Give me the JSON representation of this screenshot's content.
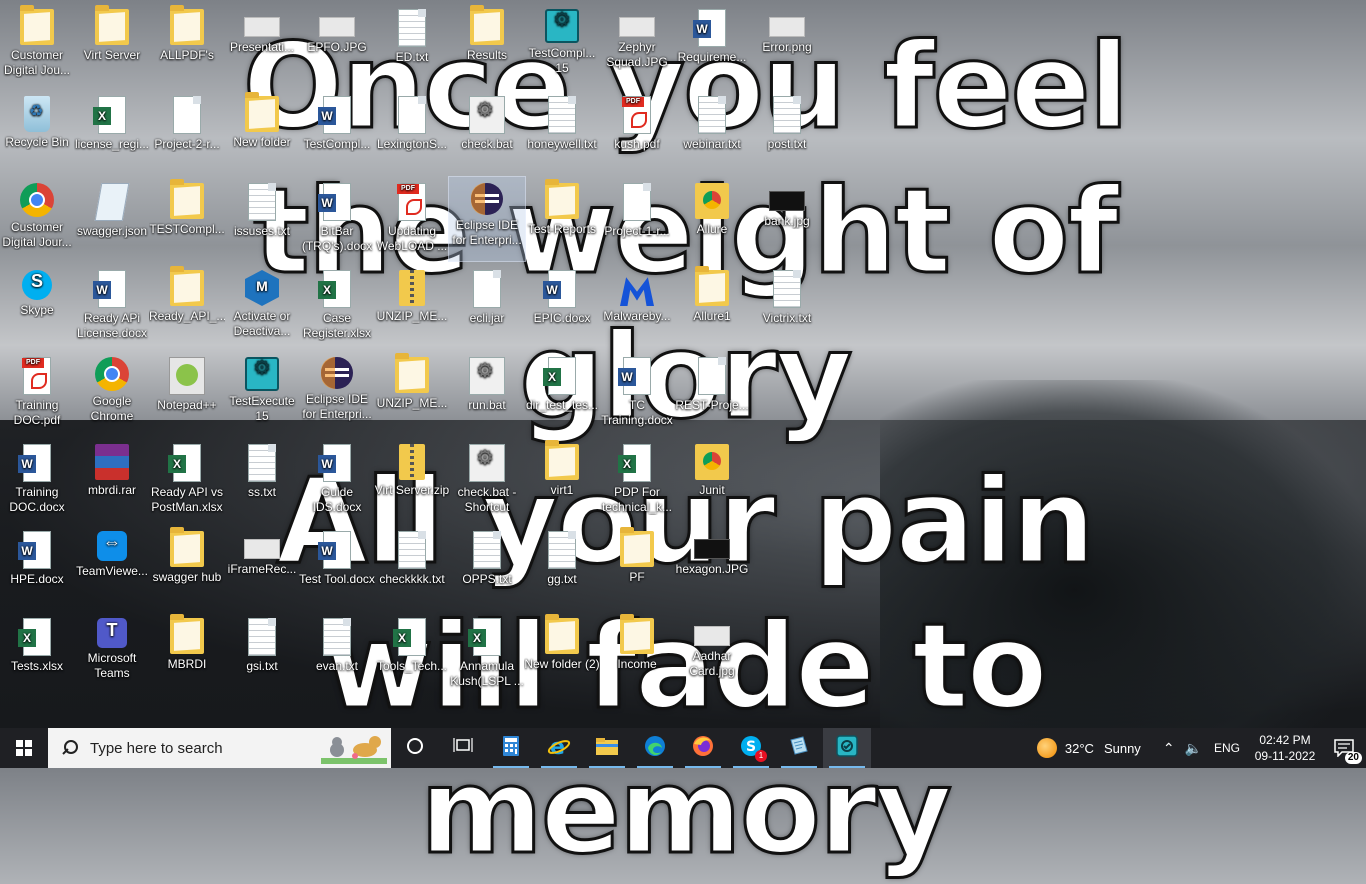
{
  "wallpaper": {
    "text": "Once you feel\nthe weight of glory\nAll your pain\nwill fade to\nmemory"
  },
  "desktop_icons": [
    {
      "label": "Customer Digital Jou...",
      "icon": "folder-icon"
    },
    {
      "label": "Recycle Bin",
      "icon": "recycle-bin-icon"
    },
    {
      "label": "Customer Digital Jour...",
      "icon": "chrome-icon"
    },
    {
      "label": "Skype",
      "icon": "skype-icon"
    },
    {
      "label": "Training DOC.pdf",
      "icon": "pdf-icon"
    },
    {
      "label": "Training DOC.docx",
      "icon": "word-icon"
    },
    {
      "label": "HPE.docx",
      "icon": "word-icon"
    },
    {
      "label": "Tests.xlsx",
      "icon": "excel-icon"
    },
    {
      "label": "Virt Server",
      "icon": "folder-icon"
    },
    {
      "label": "license_regi...",
      "icon": "excel-icon"
    },
    {
      "label": "swagger.json",
      "icon": "json-icon"
    },
    {
      "label": "Ready APi License.docx",
      "icon": "word-icon"
    },
    {
      "label": "Google Chrome",
      "icon": "chrome-icon"
    },
    {
      "label": "mbrdi.rar",
      "icon": "rar-icon"
    },
    {
      "label": "TeamViewe...",
      "icon": "teamviewer-icon"
    },
    {
      "label": "Microsoft Teams",
      "icon": "teams-icon"
    },
    {
      "label": "ALLPDF's",
      "icon": "folder-icon"
    },
    {
      "label": "Project-2-r...",
      "icon": "doc-icon"
    },
    {
      "label": "TESTCompl...",
      "icon": "folder-icon"
    },
    {
      "label": "Ready_API_...",
      "icon": "folder-icon"
    },
    {
      "label": "Notepad++",
      "icon": "notepadpp-icon"
    },
    {
      "label": "Ready API vs PostMan.xlsx",
      "icon": "excel-icon"
    },
    {
      "label": "swagger hub",
      "icon": "folder-icon"
    },
    {
      "label": "MBRDI",
      "icon": "folder-icon"
    },
    {
      "label": "Presentati...",
      "icon": "image-icon"
    },
    {
      "label": "New folder",
      "icon": "folder-icon"
    },
    {
      "label": "issuses.txt",
      "icon": "text-file-icon"
    },
    {
      "label": "Activate or Deactiva...",
      "icon": "activate-icon"
    },
    {
      "label": "TestExecute 15",
      "icon": "testexecute-icon"
    },
    {
      "label": "ss.txt",
      "icon": "text-file-icon"
    },
    {
      "label": "iFrameRec...",
      "icon": "image-icon"
    },
    {
      "label": "gsi.txt",
      "icon": "text-file-icon"
    },
    {
      "label": "EPFO.JPG",
      "icon": "image-icon"
    },
    {
      "label": "TestCompl...",
      "icon": "word-icon"
    },
    {
      "label": "BitBar (TRQ's).docx",
      "icon": "word-icon"
    },
    {
      "label": "Case Register.xlsx",
      "icon": "excel-icon"
    },
    {
      "label": "Eclipse IDE for Enterpri...",
      "icon": "eclipse-icon"
    },
    {
      "label": "Guide IDS.docx",
      "icon": "word-icon"
    },
    {
      "label": "Test Tool.docx",
      "icon": "word-icon"
    },
    {
      "label": "evan.txt",
      "icon": "text-file-icon"
    },
    {
      "label": "ED.txt",
      "icon": "text-file-icon"
    },
    {
      "label": "LexingtonS...",
      "icon": "doc-icon"
    },
    {
      "label": "Updating WebLOAD ...",
      "icon": "pdf-icon"
    },
    {
      "label": "UNZIP_ME...",
      "icon": "zip-icon"
    },
    {
      "label": "UNZIP_ME...",
      "icon": "folder-icon"
    },
    {
      "label": "Virt Server.zip",
      "icon": "zip-icon"
    },
    {
      "label": "checkkkk.txt",
      "icon": "text-file-icon"
    },
    {
      "label": "Tools_Tech...",
      "icon": "excel-icon"
    },
    {
      "label": "Results",
      "icon": "folder-icon"
    },
    {
      "label": "check.bat",
      "icon": "bat-icon"
    },
    {
      "label": "Eclipse IDE for Enterpri...",
      "icon": "eclipse-icon"
    },
    {
      "label": "ecli.jar",
      "icon": "doc-icon"
    },
    {
      "label": "run.bat",
      "icon": "bat-icon"
    },
    {
      "label": "check.bat - Shortcut",
      "icon": "bat-icon"
    },
    {
      "label": "OPPS.txt",
      "icon": "text-file-icon"
    },
    {
      "label": "Annamula Kush(LSPL ...",
      "icon": "excel-icon"
    },
    {
      "label": "TestCompl... 15",
      "icon": "testexecute-icon"
    },
    {
      "label": "honeywell.txt",
      "icon": "text-file-icon"
    },
    {
      "label": "Test-Reports",
      "icon": "folder-icon"
    },
    {
      "label": "EPIC.docx",
      "icon": "word-icon"
    },
    {
      "label": "dir_test_tes...",
      "icon": "excel-icon"
    },
    {
      "label": "virt1",
      "icon": "folder-icon"
    },
    {
      "label": "gg.txt",
      "icon": "text-file-icon"
    },
    {
      "label": "New folder (2)",
      "icon": "folder-icon"
    },
    {
      "label": "Zephyr Squad.JPG",
      "icon": "image-icon"
    },
    {
      "label": "kush.pdf",
      "icon": "pdf-icon"
    },
    {
      "label": "Project-1-r...",
      "icon": "doc-icon"
    },
    {
      "label": "Malwareby...",
      "icon": "malwarebytes-icon"
    },
    {
      "label": "TC Training.docx",
      "icon": "word-icon"
    },
    {
      "label": "PDP For technical_k...",
      "icon": "excel-icon"
    },
    {
      "label": "PF",
      "icon": "folder-icon"
    },
    {
      "label": "Income",
      "icon": "folder-icon"
    },
    {
      "label": "Requireme...",
      "icon": "word-icon"
    },
    {
      "label": "webinar.txt",
      "icon": "text-file-icon"
    },
    {
      "label": "Allure",
      "icon": "allure-icon"
    },
    {
      "label": "Allure1",
      "icon": "folder-icon"
    },
    {
      "label": "REST-Proje...",
      "icon": "doc-icon"
    },
    {
      "label": "Junit",
      "icon": "allure-icon"
    },
    {
      "label": "hexagon.JPG",
      "icon": "image-dark-icon"
    },
    {
      "label": "Aadhar Card.jpg",
      "icon": "image-icon"
    },
    {
      "label": "Error.png",
      "icon": "image-icon"
    },
    {
      "label": "post.txt",
      "icon": "text-file-icon"
    },
    {
      "label": "bank.jpg",
      "icon": "image-dark-icon"
    },
    {
      "label": "Victrix.txt",
      "icon": "text-file-icon"
    }
  ],
  "taskbar": {
    "search_placeholder": "Type here to search",
    "apps": [
      {
        "name": "Cortana",
        "icon": "cortana-icon"
      },
      {
        "name": "Task View",
        "icon": "task-view-icon"
      },
      {
        "name": "Calculator",
        "icon": "calculator-icon"
      },
      {
        "name": "Internet Explorer",
        "icon": "ie-icon"
      },
      {
        "name": "File Explorer",
        "icon": "file-explorer-icon"
      },
      {
        "name": "Microsoft Edge",
        "icon": "edge-icon"
      },
      {
        "name": "Firefox",
        "icon": "firefox-icon"
      },
      {
        "name": "Skype",
        "icon": "skype-icon",
        "badge": "1"
      },
      {
        "name": "Notepad",
        "icon": "notepad-icon"
      },
      {
        "name": "TestExecute",
        "icon": "testexecute-icon"
      }
    ],
    "weather": {
      "temp": "32°C",
      "condition": "Sunny"
    },
    "tray": {
      "language": "ENG",
      "time": "02:42 PM",
      "date": "09-11-2022",
      "notifications": "20"
    }
  }
}
